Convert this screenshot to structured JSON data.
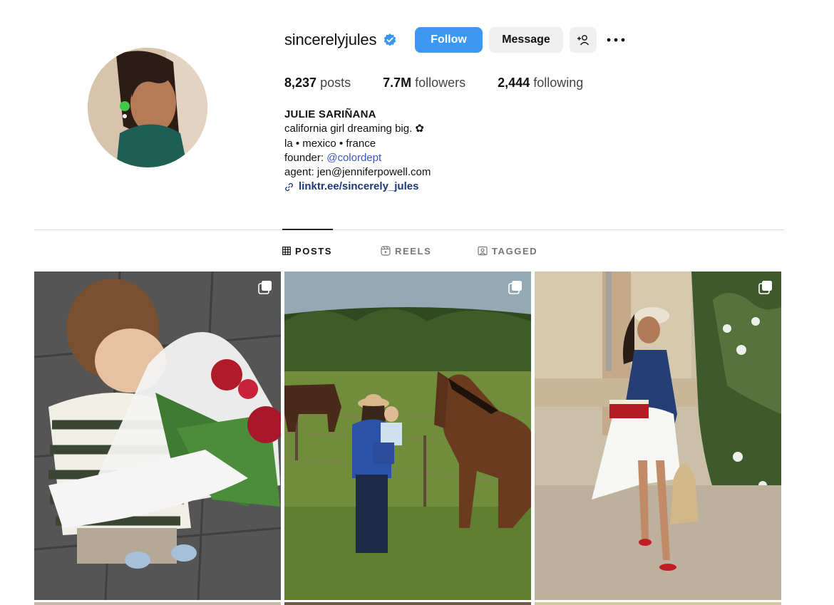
{
  "profile": {
    "username": "sincerelyjules",
    "verified": true,
    "buttons": {
      "follow": "Follow",
      "message": "Message"
    },
    "stats": {
      "posts_count": "8,237",
      "posts_label": "posts",
      "followers_count": "7.7M",
      "followers_label": "followers",
      "following_count": "2,444",
      "following_label": "following"
    },
    "bio": {
      "full_name": "JULIE SARIÑANA",
      "line1": "california girl dreaming big. ✿",
      "line2": "la • mexico • france",
      "founder_prefix": "founder: ",
      "founder_mention": "@colordept",
      "agent": "agent: jen@jenniferpowell.com",
      "link": "linktr.ee/sincerely_jules"
    }
  },
  "tabs": [
    {
      "label": "POSTS",
      "icon": "grid-icon",
      "active": true
    },
    {
      "label": "REELS",
      "icon": "reels-icon",
      "active": false
    },
    {
      "label": "TAGGED",
      "icon": "tagged-icon",
      "active": false
    }
  ],
  "posts": [
    {
      "subject": "child-with-peonies",
      "multiple": true
    },
    {
      "subject": "horses-in-field",
      "multiple": true
    },
    {
      "subject": "woman-with-strawberries",
      "multiple": true
    }
  ],
  "colors": {
    "follow_button": "#3d98f1",
    "secondary_button": "#efefef",
    "verified_badge": "#3897f0",
    "mention": "#3a55c4",
    "link": "#1e3a74"
  }
}
